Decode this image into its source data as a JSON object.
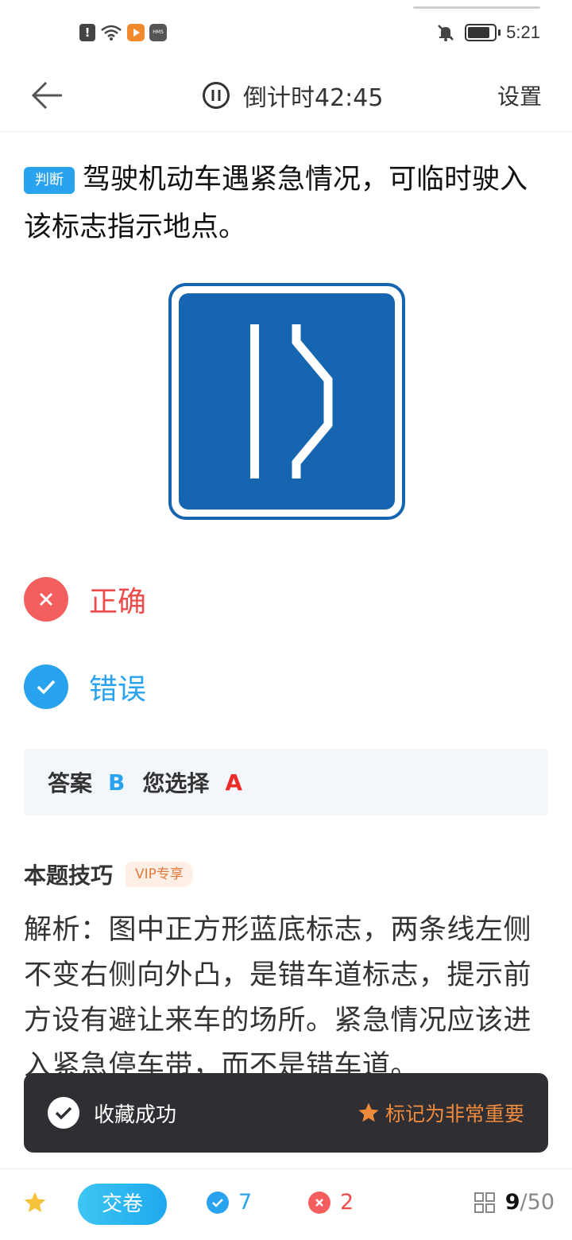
{
  "status_bar": {
    "time": "5:21",
    "icons": [
      "alert-icon",
      "wifi-icon",
      "app-notification-icon",
      "hms-icon",
      "mute-icon",
      "battery-icon"
    ],
    "hms_label": "HMS"
  },
  "header": {
    "timer_label": "倒计时42:45",
    "settings_label": "设置"
  },
  "question": {
    "type_tag": "判断",
    "text": "驾驶机动车遇紧急情况，可临时驶入该标志指示地点。"
  },
  "options": [
    {
      "label": "正确",
      "state": "wrong-selected"
    },
    {
      "label": "错误",
      "state": "correct"
    }
  ],
  "answer": {
    "answer_label": "答案",
    "answer_value": "B",
    "chosen_label": "您选择",
    "chosen_value": "A"
  },
  "skills": {
    "title": "本题技巧",
    "vip_tag": "VIP专享",
    "analysis": "解析：图中正方形蓝底标志，两条线左侧不变右侧向外凸，是错车道标志，提示前方设有避让来车的场所。紧急情况应该进入紧急停车带，而不是错车道。"
  },
  "toast": {
    "message": "收藏成功",
    "action": "标记为非常重要"
  },
  "bottom_bar": {
    "submit_label": "交卷",
    "correct_count": "7",
    "wrong_count": "2",
    "current": "9",
    "total": "/50"
  },
  "colors": {
    "accent_blue": "#2aa3ee",
    "error_red": "#f55e5e",
    "sign_blue": "#1565b0",
    "toast_bg": "#2f2f33",
    "toast_action": "#f08a3c"
  }
}
